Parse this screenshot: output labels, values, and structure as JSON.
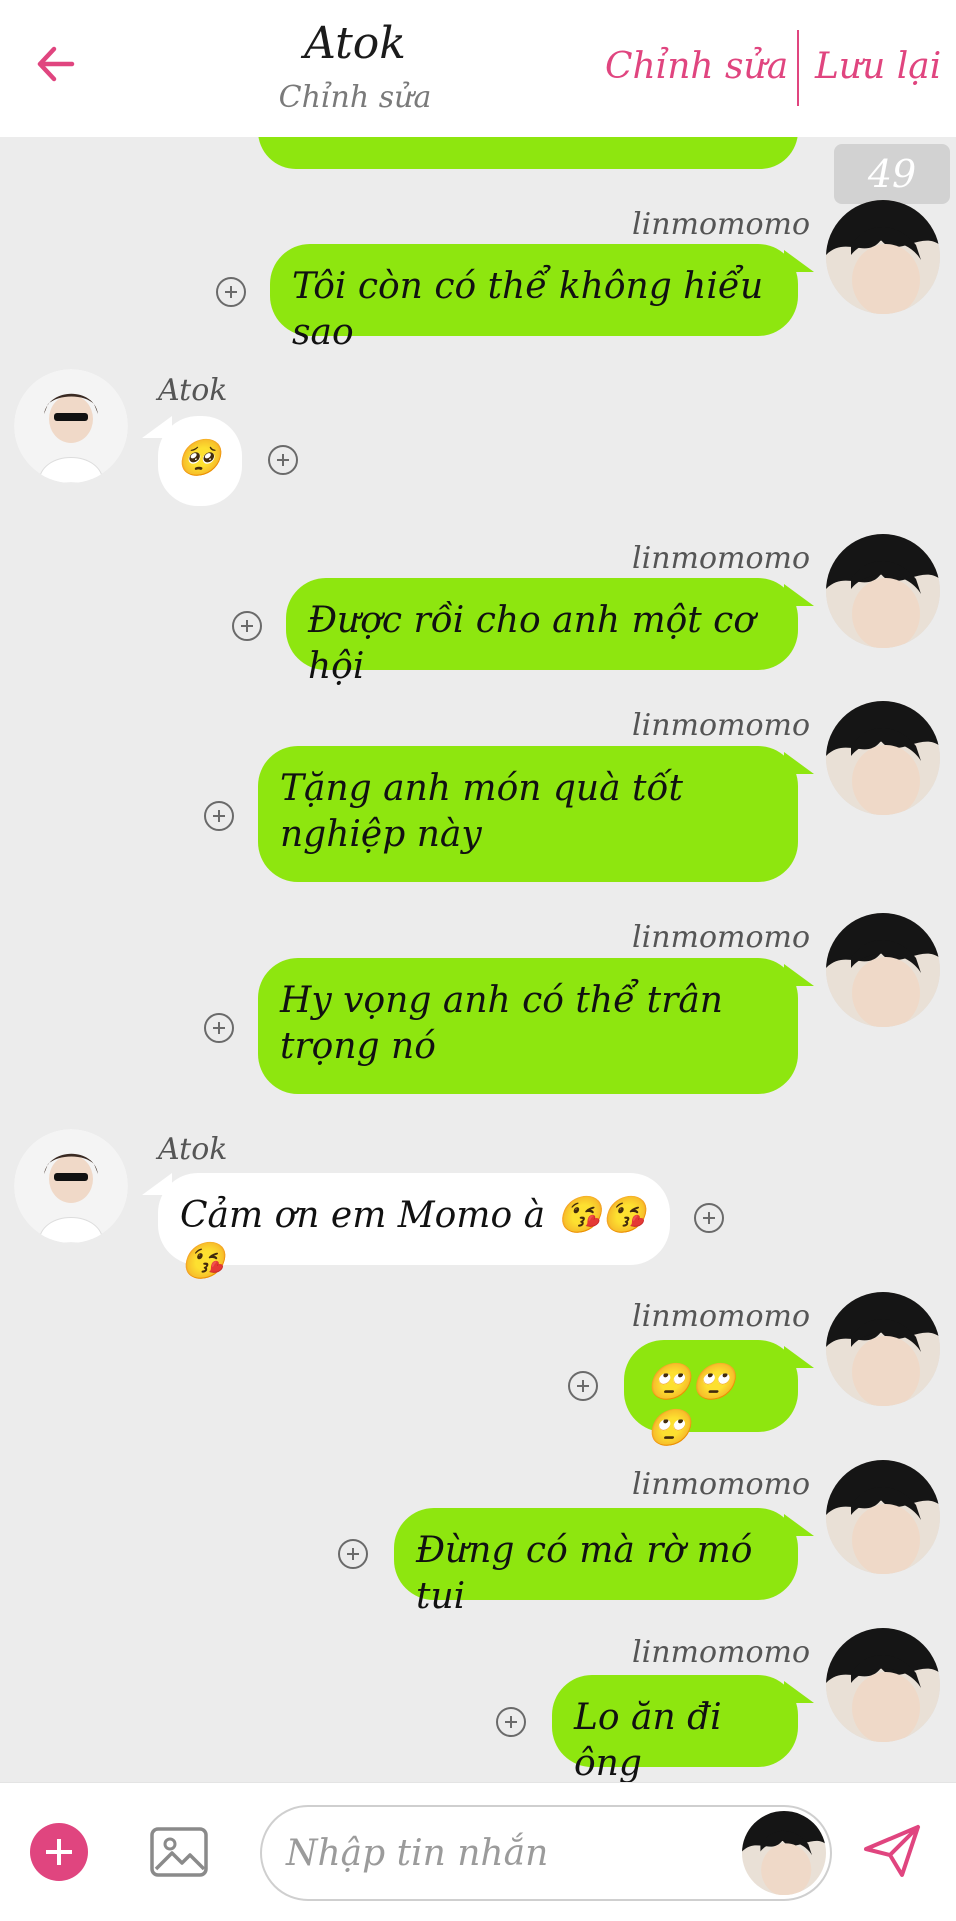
{
  "header": {
    "title": "Atok",
    "subtitle": "Chỉnh sửa",
    "edit_label": "Chỉnh sửa",
    "save_label": "Lưu lại"
  },
  "badge": "49 joy",
  "messages": [
    {
      "side": "right",
      "sender": "linmomomo",
      "text": "Tôi còn có thể không hiểu sao"
    },
    {
      "side": "left",
      "sender": "Atok",
      "text": "🥺"
    },
    {
      "side": "right",
      "sender": "linmomomo",
      "text": "Được rồi cho anh một cơ hội"
    },
    {
      "side": "right",
      "sender": "linmomomo",
      "text": "Tặng anh món quà tốt nghiệp này"
    },
    {
      "side": "right",
      "sender": "linmomomo",
      "text": "Hy vọng anh có thể trân trọng nó"
    },
    {
      "side": "left",
      "sender": "Atok",
      "text": "Cảm ơn em Momo à 😘😘😘"
    },
    {
      "side": "right",
      "sender": "linmomomo",
      "text": "🙄🙄🙄"
    },
    {
      "side": "right",
      "sender": "linmomomo",
      "text": "Đừng có mà rờ mó tui"
    },
    {
      "side": "right",
      "sender": "linmomomo",
      "text": "Lo ăn đi ông"
    }
  ],
  "input": {
    "placeholder": "Nhập tin nhắn"
  },
  "colors": {
    "accent": "#e0457f",
    "bubble_green": "#8ee60f",
    "background": "#ececec"
  }
}
